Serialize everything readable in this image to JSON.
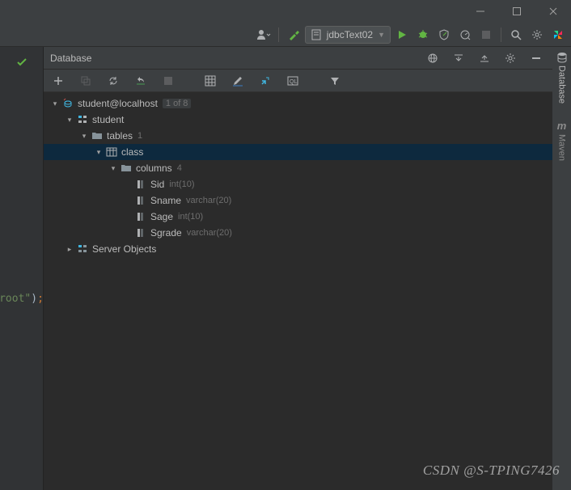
{
  "titlebar": {},
  "toolbar": {
    "run_config": "jdbcText02"
  },
  "panel": {
    "title": "Database"
  },
  "tree": {
    "datasource": "student@localhost",
    "datasource_badge": "1 of 8",
    "schema": "student",
    "tables_label": "tables",
    "tables_count": "1",
    "table_class": "class",
    "columns_label": "columns",
    "columns_count": "4",
    "cols": [
      {
        "name": "Sid",
        "type": "int(10)"
      },
      {
        "name": "Sname",
        "type": "varchar(20)"
      },
      {
        "name": "Sage",
        "type": "int(10)"
      },
      {
        "name": "Sgrade",
        "type": "varchar(20)"
      }
    ],
    "server_objects": "Server Objects"
  },
  "code": {
    "root": "root\""
  },
  "right": {
    "database": "Database",
    "maven": "Maven"
  },
  "watermark": "CSDN @S-TPING7426"
}
